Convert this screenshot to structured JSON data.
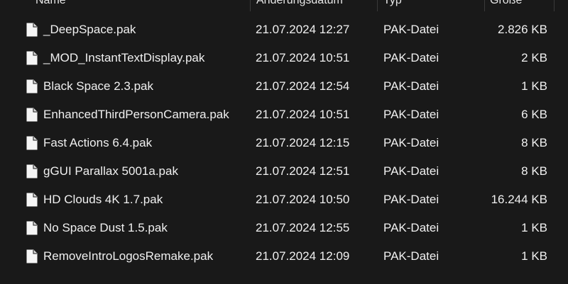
{
  "columns": {
    "name": "Name",
    "date": "Änderungsdatum",
    "type": "Typ",
    "size": "Größe"
  },
  "files": [
    {
      "name": "_DeepSpace.pak",
      "date": "21.07.2024 12:27",
      "type": "PAK-Datei",
      "size": "2.826 KB",
      "icon": "file-icon"
    },
    {
      "name": "_MOD_InstantTextDisplay.pak",
      "date": "21.07.2024 10:51",
      "type": "PAK-Datei",
      "size": "2 KB",
      "icon": "file-icon"
    },
    {
      "name": "Black Space 2.3.pak",
      "date": "21.07.2024 12:54",
      "type": "PAK-Datei",
      "size": "1 KB",
      "icon": "file-icon"
    },
    {
      "name": "EnhancedThirdPersonCamera.pak",
      "date": "21.07.2024 10:51",
      "type": "PAK-Datei",
      "size": "6 KB",
      "icon": "file-icon"
    },
    {
      "name": "Fast Actions 6.4.pak",
      "date": "21.07.2024 12:15",
      "type": "PAK-Datei",
      "size": "8 KB",
      "icon": "file-icon"
    },
    {
      "name": "gGUI Parallax  5001a.pak",
      "date": "21.07.2024 12:51",
      "type": "PAK-Datei",
      "size": "8 KB",
      "icon": "file-icon"
    },
    {
      "name": "HD Clouds 4K 1.7.pak",
      "date": "21.07.2024 10:50",
      "type": "PAK-Datei",
      "size": "16.244 KB",
      "icon": "file-icon"
    },
    {
      "name": "No Space Dust 1.5.pak",
      "date": "21.07.2024 12:55",
      "type": "PAK-Datei",
      "size": "1 KB",
      "icon": "file-icon"
    },
    {
      "name": "RemoveIntroLogosRemake.pak",
      "date": "21.07.2024 12:09",
      "type": "PAK-Datei",
      "size": "1 KB",
      "icon": "file-icon"
    }
  ],
  "colors": {
    "background": "#191919",
    "text": "#f0f0f0",
    "separator": "#3a3a3a",
    "icon": "#f5f5f5"
  }
}
